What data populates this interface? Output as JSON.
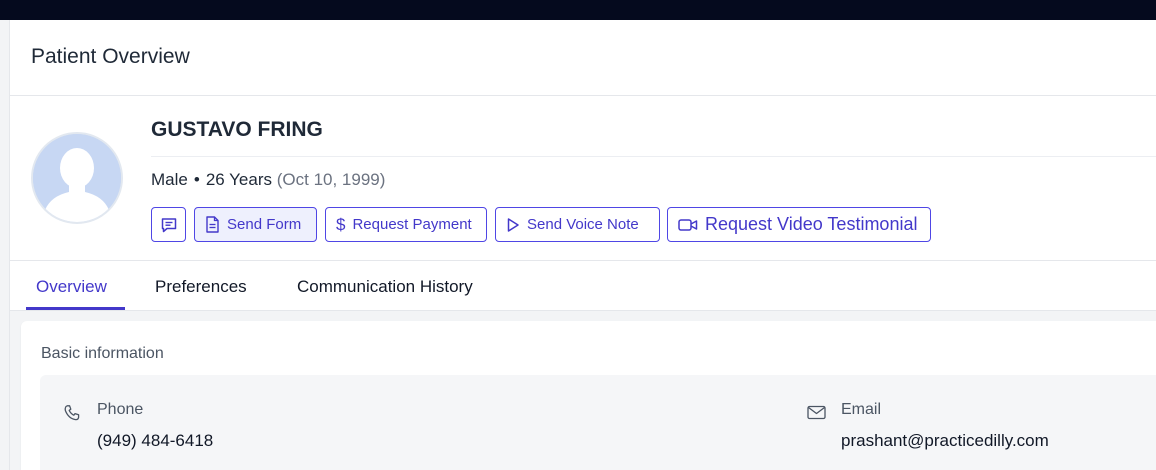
{
  "header": {
    "title": "Patient Overview"
  },
  "patient": {
    "name": "GUSTAVO FRING",
    "gender": "Male",
    "age": "26 Years",
    "dob": "(Oct 10, 1999)",
    "avatar_icon": "user-placeholder-icon"
  },
  "actions": {
    "message_icon": "message-icon",
    "send_form": {
      "label": "Send Form",
      "icon": "document-icon"
    },
    "request_payment": {
      "label": "Request Payment",
      "icon": "dollar-icon"
    },
    "send_voice_note": {
      "label": "Send Voice Note",
      "icon": "play-icon"
    },
    "request_video_testimonial": {
      "label": "Request Video Testimonial",
      "icon": "video-icon"
    }
  },
  "tabs": [
    {
      "label": "Overview",
      "active": true
    },
    {
      "label": "Preferences",
      "active": false
    },
    {
      "label": "Communication History",
      "active": false
    }
  ],
  "basic_info": {
    "title": "Basic information",
    "phone": {
      "label": "Phone",
      "value": "(949) 484-6418",
      "icon": "phone-icon"
    },
    "email": {
      "label": "Email",
      "value": "prashant@practicedilly.com",
      "icon": "mail-icon"
    }
  },
  "colors": {
    "accent": "#4338ca",
    "topbar": "#050a1e",
    "avatar_bg": "#c7d7f3"
  }
}
